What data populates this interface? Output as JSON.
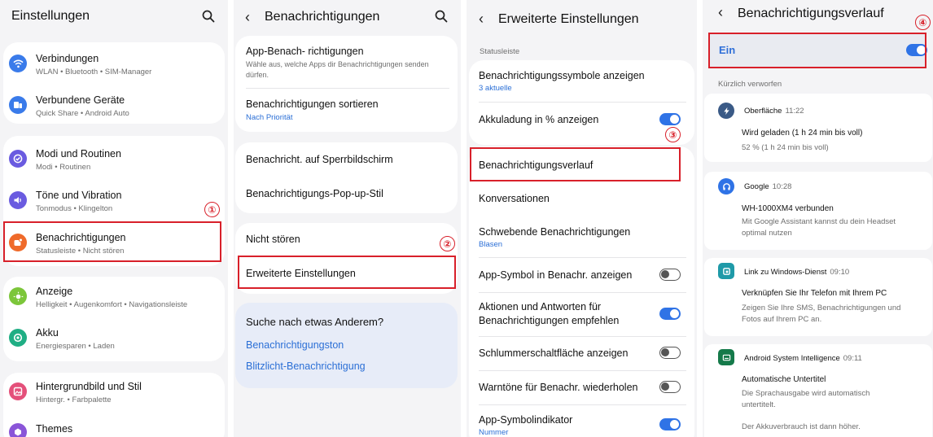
{
  "screen1": {
    "title": "Einstellungen",
    "items": [
      {
        "title": "Verbindungen",
        "sub": "WLAN • Bluetooth • SIM-Manager",
        "icon": "wifi-icon",
        "color": "#3a7bea"
      },
      {
        "title": "Verbundene Geräte",
        "sub": "Quick Share • Android Auto",
        "icon": "devices-icon",
        "color": "#3a7bea"
      },
      {
        "title": "Modi und Routinen",
        "sub": "Modi • Routinen",
        "icon": "check-circle-icon",
        "color": "#6a5be0"
      },
      {
        "title": "Töne und Vibration",
        "sub": "Tonmodus • Klingelton",
        "icon": "speaker-icon",
        "color": "#6a5be0"
      },
      {
        "title": "Benachrichtigungen",
        "sub": "Statusleiste • Nicht stören",
        "icon": "notification-icon",
        "color": "#ef6a2a"
      },
      {
        "title": "Anzeige",
        "sub": "Helligkeit • Augenkomfort • Navigationsleiste",
        "icon": "brightness-icon",
        "color": "#7cc63a"
      },
      {
        "title": "Akku",
        "sub": "Energiesparen • Laden",
        "icon": "battery-icon",
        "color": "#1fae84"
      },
      {
        "title": "Hintergrundbild und Stil",
        "sub": "Hintergr. • Farbpalette",
        "icon": "wallpaper-icon",
        "color": "#e4507a"
      },
      {
        "title": "Themes",
        "sub": "",
        "icon": "themes-icon",
        "color": "#8a55d8"
      }
    ]
  },
  "screen2": {
    "title": "Benachrichtigungen",
    "items": [
      {
        "title": "App-Benach- richtigungen",
        "sub1": "Wähle aus, welche Apps dir Benachrichtigungen senden",
        "sub2": "dürfen."
      },
      {
        "title": "Benachrichtigungen sortieren",
        "sub": "Nach Priorität"
      },
      {
        "title": "Benachricht. auf Sperrbildschirm"
      },
      {
        "title": "Benachrichtigungs-Pop-up-Stil"
      },
      {
        "title": "Nicht stören"
      },
      {
        "title": "Erweiterte Einstellungen"
      }
    ],
    "suggest": {
      "heading": "Suche nach etwas Anderem?",
      "links": [
        "Benachrichtigungston",
        "Blitzlicht-Benachrichtigung"
      ]
    }
  },
  "screen3": {
    "title": "Erweiterte Einstellungen",
    "section": "Statusleiste",
    "items": [
      {
        "title": "Benachrichtigungssymbole anzeigen",
        "sub": "3 aktuelle"
      },
      {
        "title": "Akkuladung in % anzeigen",
        "toggle": "on"
      },
      {
        "title": "Benachrichtigungsverlauf"
      },
      {
        "title": "Konversationen"
      },
      {
        "title": "Schwebende Benachrichtigungen",
        "sub": "Blasen"
      },
      {
        "title": "App-Symbol in Benachr. anzeigen",
        "toggle": "off"
      },
      {
        "title1": "Aktionen und Antworten für",
        "title2": "Benachrichtigungen empfehlen",
        "toggle": "on"
      },
      {
        "title": "Schlummerschaltfläche anzeigen",
        "toggle": "off"
      },
      {
        "title": "Warntöne für Benachr. wiederholen",
        "toggle": "off"
      },
      {
        "title": "App-Symbolindikator",
        "sub": "Nummer",
        "toggle": "on"
      }
    ]
  },
  "screen4": {
    "title": "Benachrichtigungsverlauf",
    "master": {
      "label": "Ein",
      "toggle": "on"
    },
    "section": "Kürzlich verworfen",
    "notifications": [
      {
        "app": "Oberfläche",
        "time": "11:22",
        "icon": "flash-icon",
        "color": "#3a5a86",
        "title": "Wird geladen (1 h 24 min bis voll)",
        "lines": [
          "52 % (1 h 24 min bis voll)"
        ]
      },
      {
        "app": "Google",
        "time": "10:28",
        "icon": "headphones-icon",
        "color": "#2f73e6",
        "title": "WH-1000XM4 verbunden",
        "lines": [
          "Mit Google Assistant kannst du dein Headset",
          "optimal nutzen"
        ]
      },
      {
        "app": "Link zu Windows-Dienst",
        "time": "09:10",
        "icon": "link-windows-icon",
        "color": "#1f9aa8",
        "title": "Verknüpfen Sie Ihr Telefon mit Ihrem PC",
        "lines": [
          "Zeigen Sie Ihre SMS, Benachrichtigungen und",
          "Fotos auf Ihrem PC an."
        ]
      },
      {
        "app": "Android System Intelligence",
        "time": "09:11",
        "icon": "caption-icon",
        "color": "#157a4a",
        "title": "Automatische Untertitel",
        "lines": [
          "Die Sprachausgabe wird automatisch",
          "untertitelt.",
          "",
          "Der Akkuverbrauch ist dann höher."
        ]
      }
    ]
  },
  "markers": [
    "①",
    "②",
    "③",
    "④"
  ],
  "accent_color": "#2f73e6",
  "highlight_color": "#d8202a"
}
